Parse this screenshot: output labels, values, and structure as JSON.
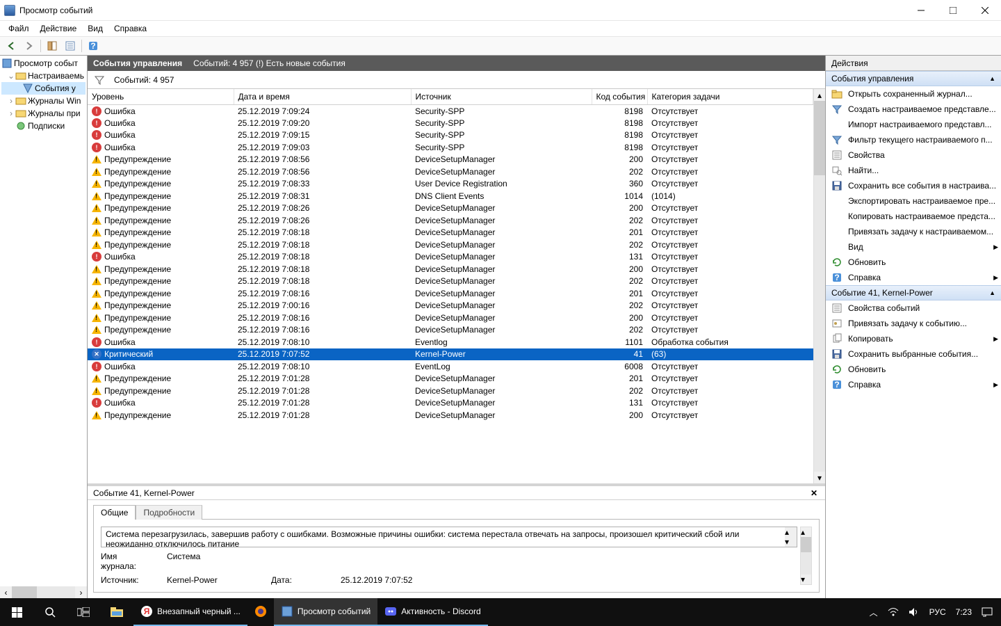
{
  "window": {
    "title": "Просмотр событий"
  },
  "menubar": [
    "Файл",
    "Действие",
    "Вид",
    "Справка"
  ],
  "tree": {
    "root": "Просмотр событ",
    "custom": "Настраиваемь",
    "custom_sel": "События у",
    "winlogs": "Журналы Win",
    "applogs": "Журналы при",
    "subs": "Подписки"
  },
  "mid": {
    "title": "События управления",
    "count_label": "Событий: 4 957 (!) Есть новые события",
    "filter_label": "Событий: 4 957"
  },
  "columns": {
    "level": "Уровень",
    "datetime": "Дата и время",
    "source": "Источник",
    "eventid": "Код события",
    "category": "Категория задачи"
  },
  "events": [
    {
      "lvl": "error",
      "lvl_t": "Ошибка",
      "dt": "25.12.2019 7:09:24",
      "src": "Security-SPP",
      "id": "8198",
      "cat": "Отсутствует"
    },
    {
      "lvl": "error",
      "lvl_t": "Ошибка",
      "dt": "25.12.2019 7:09:20",
      "src": "Security-SPP",
      "id": "8198",
      "cat": "Отсутствует"
    },
    {
      "lvl": "error",
      "lvl_t": "Ошибка",
      "dt": "25.12.2019 7:09:15",
      "src": "Security-SPP",
      "id": "8198",
      "cat": "Отсутствует"
    },
    {
      "lvl": "error",
      "lvl_t": "Ошибка",
      "dt": "25.12.2019 7:09:03",
      "src": "Security-SPP",
      "id": "8198",
      "cat": "Отсутствует"
    },
    {
      "lvl": "warn",
      "lvl_t": "Предупреждение",
      "dt": "25.12.2019 7:08:56",
      "src": "DeviceSetupManager",
      "id": "200",
      "cat": "Отсутствует"
    },
    {
      "lvl": "warn",
      "lvl_t": "Предупреждение",
      "dt": "25.12.2019 7:08:56",
      "src": "DeviceSetupManager",
      "id": "202",
      "cat": "Отсутствует"
    },
    {
      "lvl": "warn",
      "lvl_t": "Предупреждение",
      "dt": "25.12.2019 7:08:33",
      "src": "User Device Registration",
      "id": "360",
      "cat": "Отсутствует"
    },
    {
      "lvl": "warn",
      "lvl_t": "Предупреждение",
      "dt": "25.12.2019 7:08:31",
      "src": "DNS Client Events",
      "id": "1014",
      "cat": "(1014)"
    },
    {
      "lvl": "warn",
      "lvl_t": "Предупреждение",
      "dt": "25.12.2019 7:08:26",
      "src": "DeviceSetupManager",
      "id": "200",
      "cat": "Отсутствует"
    },
    {
      "lvl": "warn",
      "lvl_t": "Предупреждение",
      "dt": "25.12.2019 7:08:26",
      "src": "DeviceSetupManager",
      "id": "202",
      "cat": "Отсутствует"
    },
    {
      "lvl": "warn",
      "lvl_t": "Предупреждение",
      "dt": "25.12.2019 7:08:18",
      "src": "DeviceSetupManager",
      "id": "201",
      "cat": "Отсутствует"
    },
    {
      "lvl": "warn",
      "lvl_t": "Предупреждение",
      "dt": "25.12.2019 7:08:18",
      "src": "DeviceSetupManager",
      "id": "202",
      "cat": "Отсутствует"
    },
    {
      "lvl": "error",
      "lvl_t": "Ошибка",
      "dt": "25.12.2019 7:08:18",
      "src": "DeviceSetupManager",
      "id": "131",
      "cat": "Отсутствует"
    },
    {
      "lvl": "warn",
      "lvl_t": "Предупреждение",
      "dt": "25.12.2019 7:08:18",
      "src": "DeviceSetupManager",
      "id": "200",
      "cat": "Отсутствует"
    },
    {
      "lvl": "warn",
      "lvl_t": "Предупреждение",
      "dt": "25.12.2019 7:08:18",
      "src": "DeviceSetupManager",
      "id": "202",
      "cat": "Отсутствует"
    },
    {
      "lvl": "warn",
      "lvl_t": "Предупреждение",
      "dt": "25.12.2019 7:08:16",
      "src": "DeviceSetupManager",
      "id": "201",
      "cat": "Отсутствует"
    },
    {
      "lvl": "warn",
      "lvl_t": "Предупреждение",
      "dt": "25.12.2019 7:00:16",
      "src": "DeviceSetupManager",
      "id": "202",
      "cat": "Отсутствует"
    },
    {
      "lvl": "warn",
      "lvl_t": "Предупреждение",
      "dt": "25.12.2019 7:08:16",
      "src": "DeviceSetupManager",
      "id": "200",
      "cat": "Отсутствует"
    },
    {
      "lvl": "warn",
      "lvl_t": "Предупреждение",
      "dt": "25.12.2019 7:08:16",
      "src": "DeviceSetupManager",
      "id": "202",
      "cat": "Отсутствует"
    },
    {
      "lvl": "error",
      "lvl_t": "Ошибка",
      "dt": "25.12.2019 7:08:10",
      "src": "Eventlog",
      "id": "1101",
      "cat": "Обработка события"
    },
    {
      "lvl": "crit",
      "lvl_t": "Критический",
      "dt": "25.12.2019 7:07:52",
      "src": "Kernel-Power",
      "id": "41",
      "cat": "(63)",
      "sel": true
    },
    {
      "lvl": "error",
      "lvl_t": "Ошибка",
      "dt": "25.12.2019 7:08:10",
      "src": "EventLog",
      "id": "6008",
      "cat": "Отсутствует"
    },
    {
      "lvl": "warn",
      "lvl_t": "Предупреждение",
      "dt": "25.12.2019 7:01:28",
      "src": "DeviceSetupManager",
      "id": "201",
      "cat": "Отсутствует"
    },
    {
      "lvl": "warn",
      "lvl_t": "Предупреждение",
      "dt": "25.12.2019 7:01:28",
      "src": "DeviceSetupManager",
      "id": "202",
      "cat": "Отсутствует"
    },
    {
      "lvl": "error",
      "lvl_t": "Ошибка",
      "dt": "25.12.2019 7:01:28",
      "src": "DeviceSetupManager",
      "id": "131",
      "cat": "Отсутствует"
    },
    {
      "lvl": "warn",
      "lvl_t": "Предупреждение",
      "dt": "25.12.2019 7:01:28",
      "src": "DeviceSetupManager",
      "id": "200",
      "cat": "Отсутствует"
    }
  ],
  "detail": {
    "title": "Событие 41, Kernel-Power",
    "tab_general": "Общие",
    "tab_details": "Подробности",
    "message": "Система перезагрузилась, завершив работу с ошибками. Возможные причины ошибки: система перестала отвечать на запросы, произошел критический сбой или неожиданно отключилось питание",
    "log_lbl": "Имя журнала:",
    "log_val": "Система",
    "src_lbl": "Источник:",
    "src_val": "Kernel-Power",
    "date_lbl": "Дата:",
    "date_val": "25.12.2019 7:07:52"
  },
  "actions": {
    "header": "Действия",
    "sec1": "События управления",
    "items1": [
      {
        "ico": "folder",
        "t": "Открыть сохраненный журнал..."
      },
      {
        "ico": "filter",
        "t": "Создать настраиваемое представле..."
      },
      {
        "ico": "blank",
        "t": "Импорт настраиваемого представл..."
      },
      {
        "ico": "filter",
        "t": "Фильтр текущего настраиваемого п..."
      },
      {
        "ico": "props",
        "t": "Свойства"
      },
      {
        "ico": "find",
        "t": "Найти..."
      },
      {
        "ico": "save",
        "t": "Сохранить все события в настраива..."
      },
      {
        "ico": "blank",
        "t": "Экспортировать настраиваемое пре..."
      },
      {
        "ico": "blank",
        "t": "Копировать настраиваемое предста..."
      },
      {
        "ico": "blank",
        "t": "Привязать задачу к настраиваемом..."
      },
      {
        "ico": "blank",
        "t": "Вид",
        "arrow": true
      },
      {
        "ico": "refresh",
        "t": "Обновить"
      },
      {
        "ico": "help",
        "t": "Справка",
        "arrow": true
      }
    ],
    "sec2": "Событие 41, Kernel-Power",
    "items2": [
      {
        "ico": "props",
        "t": "Свойства событий"
      },
      {
        "ico": "task",
        "t": "Привязать задачу к событию..."
      },
      {
        "ico": "copy",
        "t": "Копировать",
        "arrow": true
      },
      {
        "ico": "save",
        "t": "Сохранить выбранные события..."
      },
      {
        "ico": "refresh",
        "t": "Обновить"
      },
      {
        "ico": "help",
        "t": "Справка",
        "arrow": true
      }
    ]
  },
  "taskbar": {
    "apps": [
      {
        "ico": "yandex",
        "label": "Внезапный черный ...",
        "open": true
      },
      {
        "ico": "firefox",
        "label": "",
        "open": false
      },
      {
        "ico": "event",
        "label": "Просмотр событий",
        "active": true
      },
      {
        "ico": "discord",
        "label": "Активность - Discord",
        "open": true
      }
    ],
    "lang": "РУС",
    "time": "7:23"
  }
}
